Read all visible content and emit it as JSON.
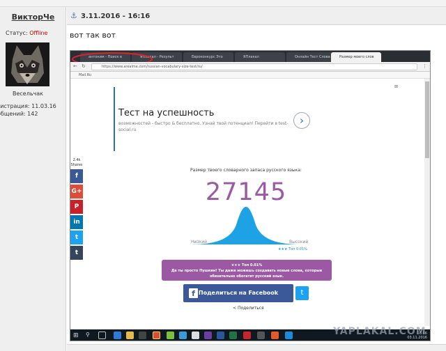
{
  "user": {
    "name": "ВикторЧе",
    "status_label": "Статус:",
    "status_value": "Offline",
    "rank": "Весельчак",
    "registration": "гистрация: 11.03.16",
    "messages": "общений: 142"
  },
  "post": {
    "date": "3.11.2016 - 16:16",
    "text": "вот так вот"
  },
  "screenshot": {
    "tabs": [
      "антоним - Поиск в",
      "ЯПлакал - Результ",
      "Евроконкурс Это",
      "ЯПлакал",
      "Онлайн Тест Слова",
      "Размер моего слов"
    ],
    "url": "https://www.arealme.com/russian-vocabulary-size-test/ru/",
    "bookmark": "Mail.Ru",
    "ad_title": "Тест на успешность",
    "ad_text": "возможностей - быстро & бесплатно. Узнай твой потенциал! Перейти в test-social.ru",
    "share_count": "2.4k",
    "share_count_label": "Shares",
    "caption": "Размер твоего словарного запаса русского языка:",
    "score": "27145",
    "low_label": "Низкий",
    "high_label": "Высокий",
    "top_label": "★★★ Топ 0.01%",
    "result_title": "★★★ Топ 0.01%",
    "result_text": "Да ты просто Пушкин! Ты даже можешь создавать новые слова, которые обязательно обогатят русский язык.",
    "fb_button": "Поделиться на Facebook",
    "share_link": "Поделиться",
    "clock_time": "16:16",
    "clock_date": "03.11.2016"
  },
  "watermark": "YAPLAKAL.COM",
  "colors": {
    "accent_purple": "#9b59a4",
    "curve_blue": "#1ea2e6",
    "facebook": "#3b5998",
    "twitter": "#1da1f2"
  }
}
